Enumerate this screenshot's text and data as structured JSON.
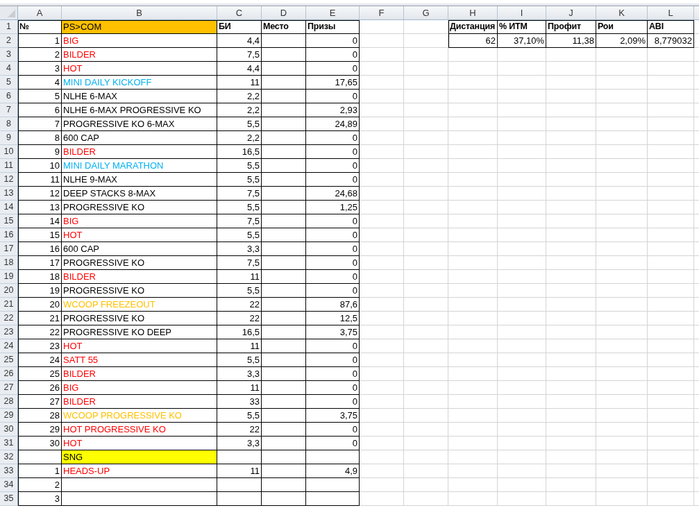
{
  "columns": [
    "A",
    "B",
    "C",
    "D",
    "E",
    "F",
    "G",
    "H",
    "I",
    "J",
    "K",
    "L"
  ],
  "rows": [
    {
      "number": "1",
      "cells": [
        {
          "text": "№",
          "kind": "header"
        },
        {
          "text": "PS>COM",
          "kind": "section",
          "color": "#ffc000"
        },
        {
          "text": "БИ",
          "kind": "header"
        },
        {
          "text": "Место",
          "kind": "header"
        },
        {
          "text": "Призы",
          "kind": "header"
        },
        {},
        {},
        {
          "text": "Дистанция",
          "kind": "header"
        },
        {
          "text": "% ИТМ",
          "kind": "header"
        },
        {
          "text": "Профит",
          "kind": "header"
        },
        {
          "text": "Рои",
          "kind": "header"
        },
        {
          "text": "ABI",
          "kind": "header"
        }
      ]
    },
    {
      "number": "2",
      "cells": [
        {
          "text": "1"
        },
        {
          "text": "BIG",
          "color": "#ff0000"
        },
        {
          "text": "4,4"
        },
        {
          "bordered": true
        },
        {
          "text": "0"
        },
        {},
        {},
        {
          "text": "62"
        },
        {
          "text": "37,10%"
        },
        {
          "text": "11,38"
        },
        {
          "text": "2,09%"
        },
        {
          "text": "8,779032"
        }
      ]
    },
    {
      "number": "3",
      "cells": [
        {
          "text": "2"
        },
        {
          "text": "BILDER",
          "color": "#ff0000"
        },
        {
          "text": "7,5"
        },
        {
          "bordered": true
        },
        {
          "text": "0"
        }
      ]
    },
    {
      "number": "4",
      "cells": [
        {
          "text": "3"
        },
        {
          "text": "HOT",
          "color": "#ff0000"
        },
        {
          "text": "4,4"
        },
        {
          "bordered": true
        },
        {
          "text": "0"
        }
      ]
    },
    {
      "number": "5",
      "cells": [
        {
          "text": "4"
        },
        {
          "text": "MINI DAILY KICKOFF",
          "color": "#00b0f0"
        },
        {
          "text": "11"
        },
        {
          "bordered": true
        },
        {
          "text": "17,65"
        }
      ]
    },
    {
      "number": "6",
      "cells": [
        {
          "text": "5"
        },
        {
          "text": "NLHE 6-MAX"
        },
        {
          "text": "2,2"
        },
        {
          "bordered": true
        },
        {
          "text": "0"
        }
      ]
    },
    {
      "number": "7",
      "cells": [
        {
          "text": "6"
        },
        {
          "text": "NLHE 6-MAX PROGRESSIVE KO"
        },
        {
          "text": "2,2"
        },
        {
          "bordered": true
        },
        {
          "text": "2,93"
        }
      ]
    },
    {
      "number": "8",
      "cells": [
        {
          "text": "7"
        },
        {
          "text": "PROGRESSIVE KO 6-MAX"
        },
        {
          "text": "5,5"
        },
        {
          "bordered": true
        },
        {
          "text": "24,89"
        }
      ]
    },
    {
      "number": "9",
      "cells": [
        {
          "text": "8"
        },
        {
          "text": "600 CAP"
        },
        {
          "text": "2,2"
        },
        {
          "bordered": true
        },
        {
          "text": "0"
        }
      ]
    },
    {
      "number": "10",
      "cells": [
        {
          "text": "9"
        },
        {
          "text": "BILDER",
          "color": "#ff0000"
        },
        {
          "text": "16,5"
        },
        {
          "bordered": true
        },
        {
          "text": "0"
        }
      ]
    },
    {
      "number": "11",
      "cells": [
        {
          "text": "10"
        },
        {
          "text": "MINI DAILY MARATHON",
          "color": "#00b0f0"
        },
        {
          "text": "5,5"
        },
        {
          "bordered": true
        },
        {
          "text": "0"
        }
      ]
    },
    {
      "number": "12",
      "cells": [
        {
          "text": "11"
        },
        {
          "text": "NLHE 9-MAX"
        },
        {
          "text": "5,5"
        },
        {
          "bordered": true
        },
        {
          "text": "0"
        }
      ]
    },
    {
      "number": "13",
      "cells": [
        {
          "text": "12"
        },
        {
          "text": "DEEP STACKS 8-MAX"
        },
        {
          "text": "7,5"
        },
        {
          "bordered": true
        },
        {
          "text": "24,68"
        }
      ]
    },
    {
      "number": "14",
      "cells": [
        {
          "text": "13"
        },
        {
          "text": "PROGRESSIVE KO"
        },
        {
          "text": "5,5"
        },
        {
          "bordered": true
        },
        {
          "text": "1,25"
        }
      ]
    },
    {
      "number": "15",
      "cells": [
        {
          "text": "14"
        },
        {
          "text": "BIG",
          "color": "#ff0000"
        },
        {
          "text": "7,5"
        },
        {
          "bordered": true
        },
        {
          "text": "0"
        }
      ]
    },
    {
      "number": "16",
      "cells": [
        {
          "text": "15"
        },
        {
          "text": "HOT",
          "color": "#ff0000"
        },
        {
          "text": "5,5"
        },
        {
          "bordered": true
        },
        {
          "text": "0"
        }
      ]
    },
    {
      "number": "17",
      "cells": [
        {
          "text": "16"
        },
        {
          "text": "600 CAP"
        },
        {
          "text": "3,3"
        },
        {
          "bordered": true
        },
        {
          "text": "0"
        }
      ]
    },
    {
      "number": "18",
      "cells": [
        {
          "text": "17"
        },
        {
          "text": "PROGRESSIVE KO"
        },
        {
          "text": "7,5"
        },
        {
          "bordered": true
        },
        {
          "text": "0"
        }
      ]
    },
    {
      "number": "19",
      "cells": [
        {
          "text": "18"
        },
        {
          "text": "BILDER",
          "color": "#ff0000"
        },
        {
          "text": "11"
        },
        {
          "bordered": true
        },
        {
          "text": "0"
        }
      ]
    },
    {
      "number": "20",
      "cells": [
        {
          "text": "19"
        },
        {
          "text": "PROGRESSIVE KO"
        },
        {
          "text": "5,5"
        },
        {
          "bordered": true
        },
        {
          "text": "0"
        }
      ]
    },
    {
      "number": "21",
      "cells": [
        {
          "text": "20"
        },
        {
          "text": "WCOOP FREEZEOUT",
          "color": "#ffc000"
        },
        {
          "text": "22"
        },
        {
          "bordered": true
        },
        {
          "text": "87,6"
        }
      ]
    },
    {
      "number": "22",
      "cells": [
        {
          "text": "21"
        },
        {
          "text": "PROGRESSIVE KO"
        },
        {
          "text": "22"
        },
        {
          "bordered": true
        },
        {
          "text": "12,5"
        }
      ]
    },
    {
      "number": "23",
      "cells": [
        {
          "text": "22"
        },
        {
          "text": "PROGRESSIVE KO DEEP"
        },
        {
          "text": "16,5"
        },
        {
          "bordered": true
        },
        {
          "text": "3,75"
        }
      ]
    },
    {
      "number": "24",
      "cells": [
        {
          "text": "23"
        },
        {
          "text": "HOT",
          "color": "#ff0000"
        },
        {
          "text": "11"
        },
        {
          "bordered": true
        },
        {
          "text": "0"
        }
      ]
    },
    {
      "number": "25",
      "cells": [
        {
          "text": "24"
        },
        {
          "text": "SATT 55",
          "color": "#ff0000"
        },
        {
          "text": "5,5"
        },
        {
          "bordered": true
        },
        {
          "text": "0"
        }
      ]
    },
    {
      "number": "26",
      "cells": [
        {
          "text": "25"
        },
        {
          "text": "BILDER",
          "color": "#ff0000"
        },
        {
          "text": "3,3"
        },
        {
          "bordered": true
        },
        {
          "text": "0"
        }
      ]
    },
    {
      "number": "27",
      "cells": [
        {
          "text": "26"
        },
        {
          "text": "BIG",
          "color": "#ff0000"
        },
        {
          "text": "11"
        },
        {
          "bordered": true
        },
        {
          "text": "0"
        }
      ]
    },
    {
      "number": "28",
      "cells": [
        {
          "text": "27"
        },
        {
          "text": "BILDER",
          "color": "#ff0000"
        },
        {
          "text": "33"
        },
        {
          "bordered": true
        },
        {
          "text": "0"
        }
      ]
    },
    {
      "number": "29",
      "cells": [
        {
          "text": "28"
        },
        {
          "text": "WCOOP PROGRESSIVE KO",
          "color": "#ffc000"
        },
        {
          "text": "5,5"
        },
        {
          "bordered": true
        },
        {
          "text": "3,75"
        }
      ]
    },
    {
      "number": "30",
      "cells": [
        {
          "text": "29"
        },
        {
          "text": "HOT PROGRESSIVE KO",
          "color": "#ff0000"
        },
        {
          "text": "22"
        },
        {
          "bordered": true
        },
        {
          "text": "0"
        }
      ]
    },
    {
      "number": "31",
      "cells": [
        {
          "text": "30"
        },
        {
          "text": "HOT",
          "color": "#ff0000"
        },
        {
          "text": "3,3"
        },
        {
          "bordered": true
        },
        {
          "text": "0"
        }
      ]
    },
    {
      "number": "32",
      "cells": [
        {
          "bordered": true
        },
        {
          "text": "SNG",
          "kind": "section",
          "color": "#ffff00"
        },
        {
          "bordered": true
        },
        {
          "bordered": true
        },
        {
          "bordered": true
        }
      ]
    },
    {
      "number": "33",
      "cells": [
        {
          "text": "1"
        },
        {
          "text": "HEADS-UP",
          "color": "#ff0000"
        },
        {
          "text": "11"
        },
        {
          "bordered": true
        },
        {
          "text": "4,9"
        }
      ]
    },
    {
      "number": "34",
      "cells": [
        {
          "text": "2"
        },
        {
          "bordered": true
        },
        {
          "bordered": true
        },
        {
          "bordered": true
        },
        {
          "bordered": true
        }
      ]
    },
    {
      "number": "35",
      "cells": [
        {
          "text": "3"
        },
        {
          "bordered": true
        },
        {
          "bordered": true
        },
        {
          "bordered": true
        },
        {
          "bordered": true
        }
      ]
    }
  ]
}
